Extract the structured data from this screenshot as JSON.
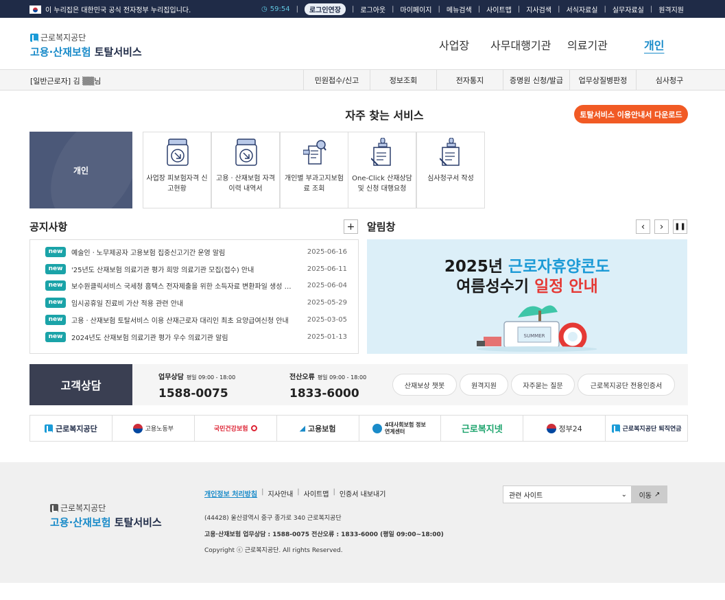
{
  "topbar": {
    "gov_text": "이 누리집은 대한민국 공식 전자정부 누리집입니다.",
    "time": "59:54",
    "extend": "로그인연장",
    "links": [
      "로그아웃",
      "마이페이지",
      "메뉴검색",
      "사이트맵",
      "지사검색",
      "서식자료실",
      "실무자료실",
      "원격지원"
    ]
  },
  "header": {
    "org": "근로복지공단",
    "svc_a": "고용·산재보험",
    "svc_b": "토탈서비스",
    "nav": [
      "사업장",
      "사무대행기관",
      "의료기관",
      "개인"
    ],
    "nav_active_color": "#1a8bc9"
  },
  "subnav": {
    "user": "[일반근로자] 김 ▒▒님",
    "tabs": [
      "민원접수/신고",
      "정보조회",
      "전자통지",
      "증명원 신청/발급",
      "업무상질병판정",
      "심사청구"
    ]
  },
  "freq": {
    "title": "자주 찾는 서비스",
    "download": "토탈서비스 이용안내서 다운로드",
    "main_card": "개인",
    "items": [
      {
        "label": "사업장 피보험자격 신고현황",
        "icon": "document-download-icon"
      },
      {
        "label": "고용ㆍ산재보험 자격 이력 내역서",
        "icon": "document-download-icon"
      },
      {
        "label": "개인별 부과고지보험료 조회",
        "icon": "receipt-search-icon"
      },
      {
        "label": "One-Click 산재상담 및 신청 대행요청",
        "icon": "stamp-document-icon"
      },
      {
        "label": "심사청구서 작성",
        "icon": "stamp-document-icon"
      }
    ]
  },
  "notice": {
    "title": "공지사항",
    "more": "+",
    "badge": "new",
    "items": [
      {
        "title": "예술인ㆍ노무제공자 고용보험 집중신고기간 운영 알림",
        "date": "2025-06-16"
      },
      {
        "title": "'25년도 산재보험 의료기관 평가 희망 의료기관 모집(접수) 안내",
        "date": "2025-06-11"
      },
      {
        "title": "보수원클릭서비스 국세청 홈택스 전자제출을 위한 소득자료 변환파일 생성 안내",
        "date": "2025-06-04"
      },
      {
        "title": "임시공휴일 진료비 가산 적용 관련 안내",
        "date": "2025-05-29"
      },
      {
        "title": "고용ㆍ산재보험 토탈서비스 이용 산재근로자 대리인 최초 요양급여신청 안내",
        "date": "2025-03-05"
      },
      {
        "title": "2024년도 산재보험 의료기관 평가 우수 의료기관 알림",
        "date": "2025-01-13"
      }
    ]
  },
  "alert": {
    "title": "알림창",
    "banner_l1a": "2025년 ",
    "banner_l1b": "근로자휴양콘도",
    "banner_l2a": "여름성수기 ",
    "banner_l2b": "일정 안내",
    "banner_tag": "SUMMER"
  },
  "cs": {
    "label": "고객상담",
    "g1_title": "업무상담",
    "g1_hours": "평일 09:00 - 18:00",
    "g1_num": "1588-0075",
    "g2_title": "전산오류",
    "g2_hours": "평일 09:00 - 18:00",
    "g2_num": "1833-6000",
    "pills": [
      "산재보상 챗봇",
      "원격지원",
      "자주묻는 질문",
      "근로복지공단 전용인증서"
    ]
  },
  "links": [
    "근로복지공단",
    "고용노동부",
    "국민건강보험",
    "고용보험",
    "4대사회보험 정보연계센터",
    "근로복지넷",
    "정부24",
    "근로복지공단 퇴직연금"
  ],
  "footer": {
    "org": "근로복지공단",
    "svc_a": "고용·산재보험",
    "svc_b": "토탈서비스",
    "menu": [
      "개인정보 처리방침",
      "지사안내",
      "사이트맵",
      "인증서 내보내기"
    ],
    "address": "(44428) 울산광역시 중구 종가로 340 근로복지공단",
    "phone": "고용·산재보험 업무상담 : 1588-0075  전산오류 : 1833-6000 (평일 09:00~18:00)",
    "copyright": "Copyright ⓒ 근로복지공단. All rights Reserved.",
    "select": "관련 사이트",
    "go": "이동"
  },
  "colors": {
    "topbar": "#1f2b47",
    "accent": "#1a8bc9",
    "orange": "#f15a24",
    "badge": "#1aa3a8"
  }
}
